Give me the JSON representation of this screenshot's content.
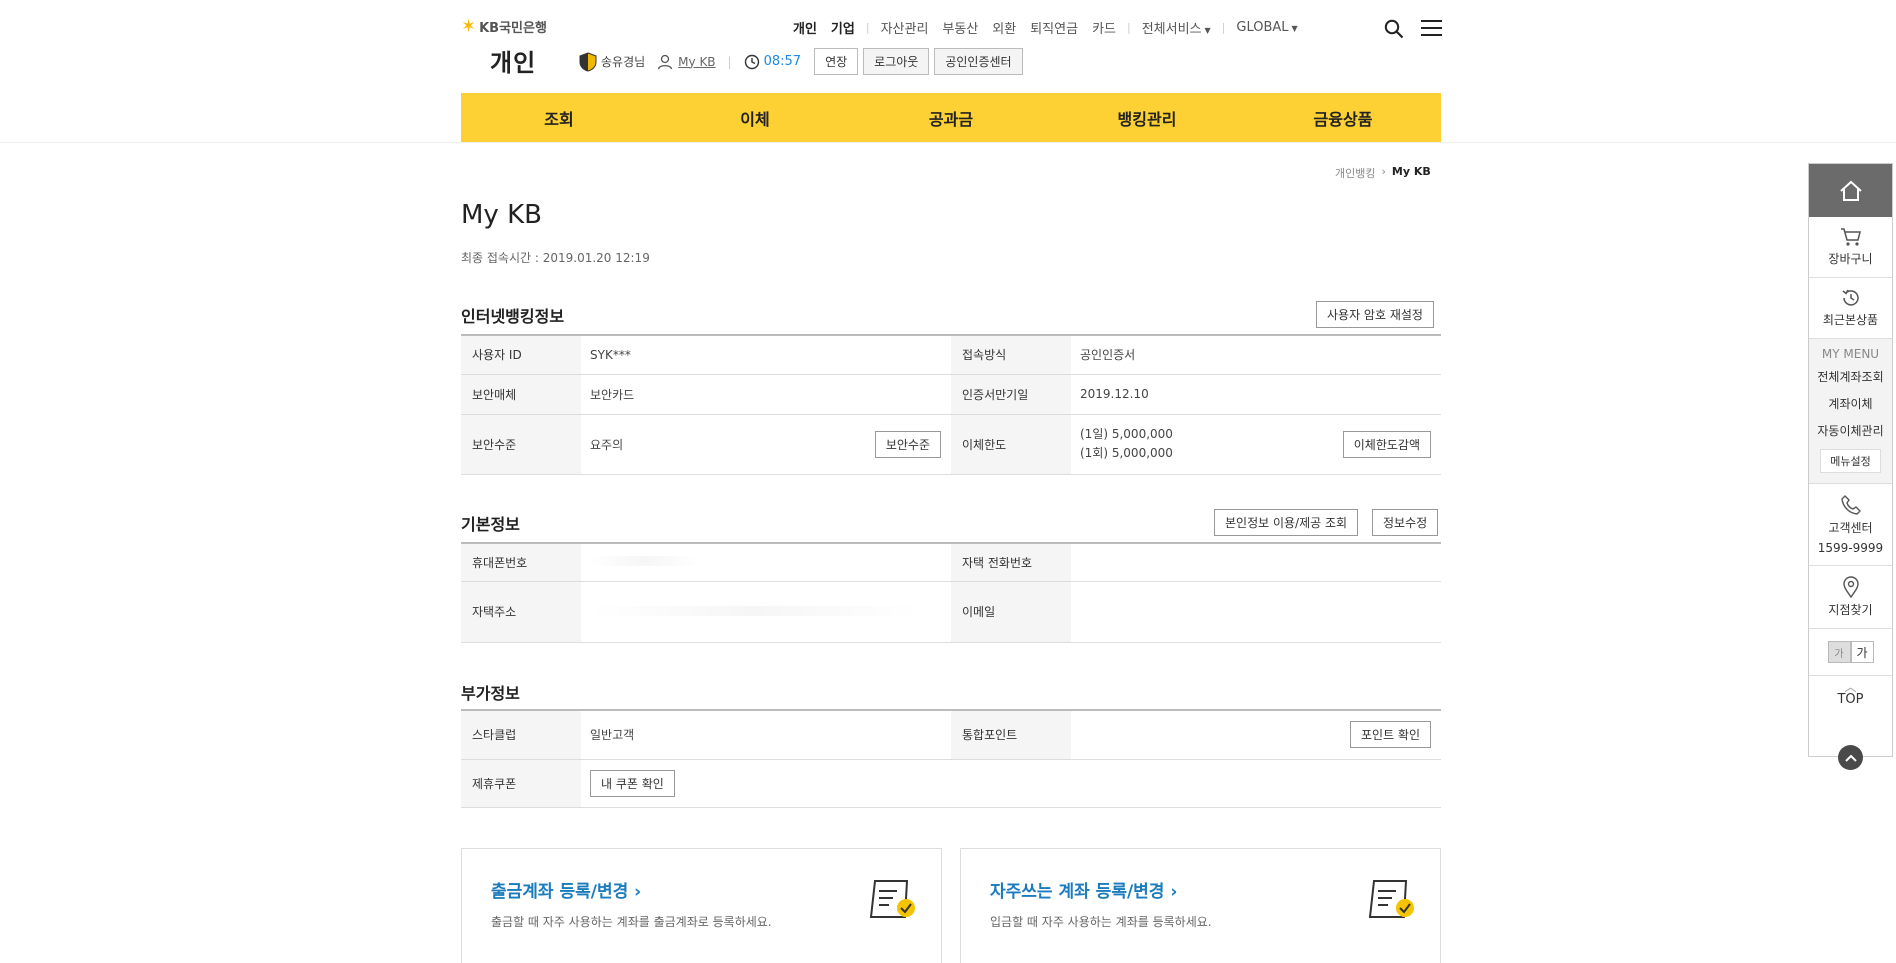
{
  "header": {
    "logo_text": "KB국민은행",
    "gnb": [
      {
        "label": "개인",
        "strong": true
      },
      {
        "label": "기업",
        "strong": true
      },
      {
        "label": "자산관리"
      },
      {
        "label": "부동산"
      },
      {
        "label": "외환"
      },
      {
        "label": "퇴직연금"
      },
      {
        "label": "카드"
      },
      {
        "label": "전체서비스"
      },
      {
        "label": "GLOBAL"
      }
    ],
    "section": "개인",
    "user_name": "송유경님",
    "mykb": "My KB",
    "session_time": "08:57",
    "extend_btn": "연장",
    "logout_btn": "로그아웃",
    "cert_btn": "공인인증센터"
  },
  "mainnav": [
    "조회",
    "이체",
    "공과금",
    "뱅킹관리",
    "금융상품"
  ],
  "breadcrumb": {
    "parent": "개인뱅킹",
    "current": "My KB"
  },
  "page": {
    "title": "My KB",
    "last_login": "최종 접속시간 : 2019.01.20 12:19"
  },
  "internet_banking": {
    "title": "인터넷뱅킹정보",
    "reset_btn": "사용자 암호 재설정",
    "user_id_label": "사용자 ID",
    "user_id": "SYK***",
    "access_label": "접속방식",
    "access": "공인인증서",
    "security_media_label": "보안매체",
    "security_media": "보안카드",
    "cert_expiry_label": "인증서만기일",
    "cert_expiry": "2019.12.10",
    "security_level_label": "보안수준",
    "security_level": "요주의",
    "security_level_btn": "보안수준",
    "transfer_limit_label": "이체한도",
    "limit_day": "(1일) 5,000,000",
    "limit_once": "(1회) 5,000,000",
    "limit_btn": "이체한도감액"
  },
  "basic_info": {
    "title": "기본정보",
    "consent_btn": "본인정보 이용/제공 조회",
    "edit_btn": "정보수정",
    "mobile_label": "휴대폰번호",
    "home_phone_label": "자택 전화번호",
    "address_label": "자택주소",
    "email_label": "이메일"
  },
  "extra_info": {
    "title": "부가정보",
    "starclub_label": "스타클럽",
    "starclub": "일반고객",
    "points_label": "통합포인트",
    "points_btn": "포인트 확인",
    "coupon_label": "제휴쿠폰",
    "coupon_btn": "내 쿠폰 확인"
  },
  "cards": [
    {
      "title": "출금계좌 등록/변경 ›",
      "desc": "출금할 때 자주 사용하는 계좌를 출금계좌로 등록하세요."
    },
    {
      "title": "자주쓰는 계좌 등록/변경 ›",
      "desc": "입금할 때 자주 사용하는 계좌를 등록하세요."
    }
  ],
  "quick": {
    "cart": "장바구니",
    "recent": "최근본상품",
    "my_menu": "MY MENU",
    "menu_links": [
      "전체계좌조회",
      "계좌이체",
      "자동이체관리"
    ],
    "menu_setting": "메뉴설정",
    "customer_center": "고객센터",
    "phone": "1599-9999",
    "branch": "지점찾기",
    "font_small": "가",
    "font_large": "가",
    "top": "TOP"
  }
}
